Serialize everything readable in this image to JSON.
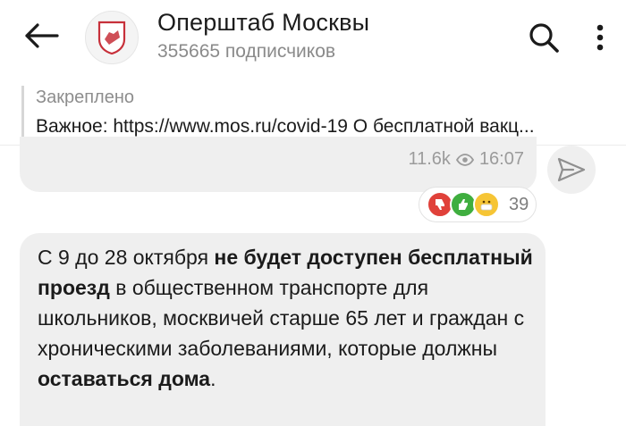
{
  "header": {
    "title": "Оперштаб Москвы",
    "subscribers": "355665 подписчиков",
    "icons": [
      "arrow-left-icon",
      "moscow-emblem-avatar",
      "search-icon",
      "more-vertical-icon"
    ]
  },
  "pinned": {
    "label": "Закреплено",
    "text": "Важное: https://www.mos.ru/covid-19 О бесплатной вакц..."
  },
  "previous_post": {
    "views": "11.6k",
    "time": "16:07",
    "icons": [
      "eye-icon",
      "share-icon"
    ]
  },
  "reactions": {
    "emojis": [
      "thumbs-down",
      "thumbs-up",
      "mask-face"
    ],
    "count": "39"
  },
  "message": {
    "p1": "С 9 до 28 октября ",
    "b1": "не будет доступен бесплатный проезд",
    "p2": " в общественном транспорте для школьников, москвичей старше 65 лет и граждан с хроническими заболеваниями, которые должны ",
    "b2": "оставаться дома",
    "p3": "."
  },
  "colors": {
    "bubble": "#efefef",
    "secondary_text": "#8a8a8a"
  }
}
